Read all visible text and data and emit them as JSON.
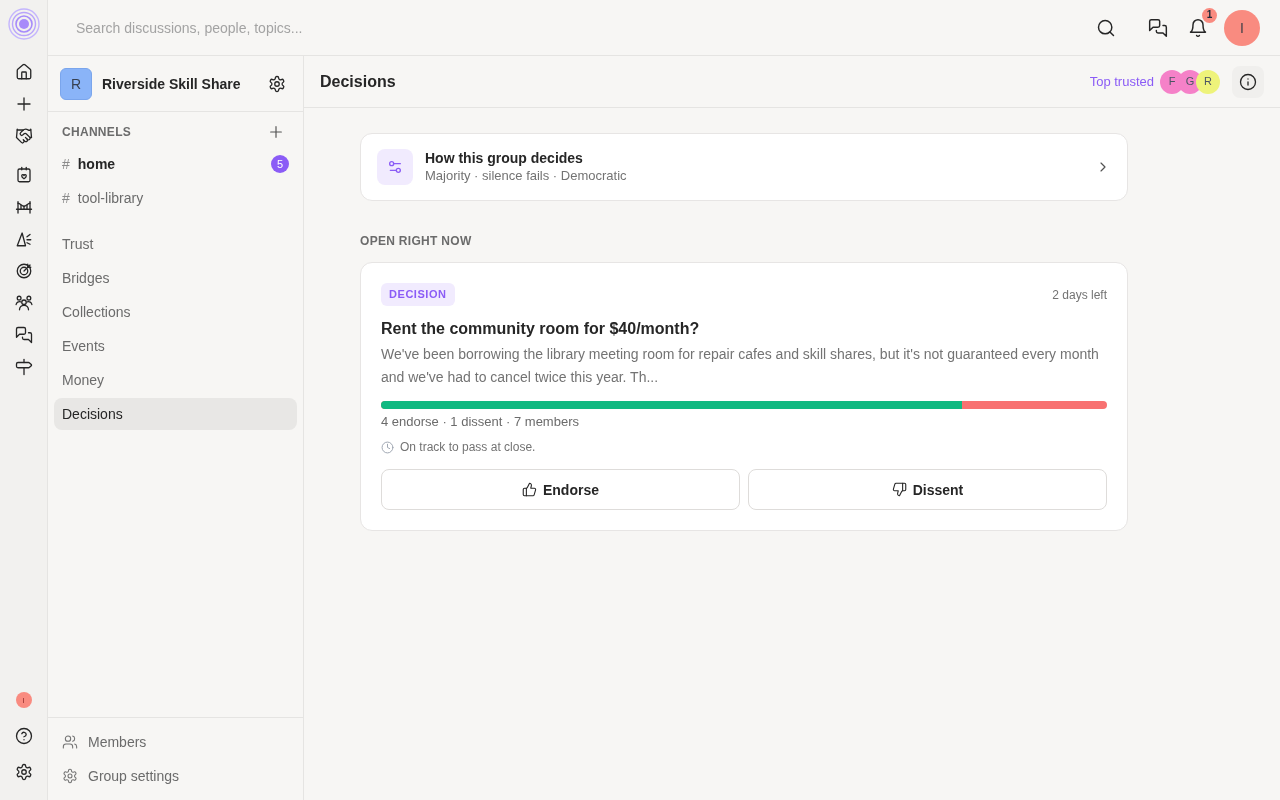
{
  "rail": {
    "user_avatar": {
      "initial": "I"
    }
  },
  "top_bar": {
    "search": {
      "placeholder": "Search discussions, people, topics..."
    },
    "notifications_badge": "1",
    "user_avatar": {
      "initial": "I"
    }
  },
  "sidebar": {
    "group": {
      "initial": "R",
      "name": "Riverside Skill Share"
    },
    "channels_heading": "CHANNELS",
    "channels": [
      {
        "prefix": "#",
        "name": "home",
        "unread": true,
        "badge": "5"
      },
      {
        "prefix": "#",
        "name": "tool-library",
        "unread": false
      }
    ],
    "items": [
      {
        "label": "Trust",
        "selected": false
      },
      {
        "label": "Bridges",
        "selected": false
      },
      {
        "label": "Collections",
        "selected": false
      },
      {
        "label": "Events",
        "selected": false
      },
      {
        "label": "Money",
        "selected": false
      },
      {
        "label": "Decisions",
        "selected": true
      }
    ],
    "footer": [
      {
        "kind": "members",
        "label": "Members"
      },
      {
        "kind": "settings",
        "label": "Group settings"
      }
    ]
  },
  "header": {
    "title": "Decisions",
    "top_trusted": {
      "label": "Top trusted",
      "avatars": [
        {
          "initial": "F",
          "color": "#f581c8"
        },
        {
          "initial": "G",
          "color": "#f581c8"
        },
        {
          "initial": "R",
          "color": "#eef37a"
        }
      ]
    }
  },
  "decision_rule": {
    "title": "How this group decides",
    "summary": "Majority · silence fails · Democratic"
  },
  "section_heading": "OPEN RIGHT NOW",
  "decisions": [
    {
      "tag": "DECISION",
      "time_left": "2 days left",
      "title": "Rent the community room for $40/month?",
      "excerpt": "We've been borrowing the library meeting room for repair cafes and skill shares, but it's not guaranteed every month and we've had to cancel twice this year. Th...",
      "level": 0.8,
      "tally": "4 endorse · 1 dissent · 7 members",
      "status": "On track to pass at close.",
      "actions": [
        {
          "kind": "endorse",
          "label": "Endorse"
        },
        {
          "kind": "dissent",
          "label": "Dissent"
        }
      ]
    }
  ]
}
